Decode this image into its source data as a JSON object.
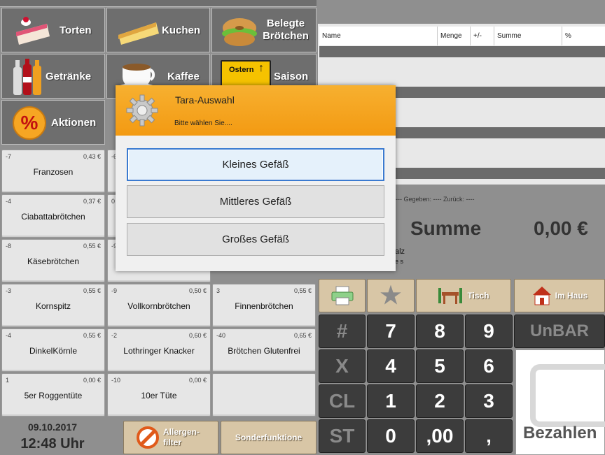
{
  "categories": [
    {
      "label": "Torten",
      "icon": "cake-icon"
    },
    {
      "label": "Kuchen",
      "icon": "pie-icon"
    },
    {
      "label": "Belegte Brötchen",
      "icon": "bagel-sandwich-icon"
    },
    {
      "label": "Getränke",
      "icon": "bottles-icon"
    },
    {
      "label": "Kaffee",
      "icon": "coffee-cup-icon"
    },
    {
      "label": "Saison",
      "icon": "signpost-icon",
      "sign_text": "Ostern"
    },
    {
      "label": "Aktionen",
      "icon": "percent-icon"
    }
  ],
  "products": [
    {
      "num": "-7",
      "price": "0,43 €",
      "name": "Franzosen"
    },
    {
      "num": "-4",
      "price": "0,37 €",
      "name": "Ciabattabrötchen"
    },
    {
      "num": "-8",
      "price": "0,55 €",
      "name": "Käsebrötchen"
    },
    {
      "num": "-3",
      "price": "0,55 €",
      "name": "Kornspitz"
    },
    {
      "num": "-9",
      "price": "0,50 €",
      "name": "Vollkornbrötchen"
    },
    {
      "num": "3",
      "price": "0,55 €",
      "name": "Finnenbrötchen"
    },
    {
      "num": "-4",
      "price": "0,55 €",
      "name": "DinkelKörnle"
    },
    {
      "num": "-2",
      "price": "0,60 €",
      "name": "Lothringer Knacker"
    },
    {
      "num": "-40",
      "price": "0,65 €",
      "name": "Brötchen Glutenfrei"
    },
    {
      "num": "1",
      "price": "0,00 €",
      "name": "5er Roggentüte"
    },
    {
      "num": "-10",
      "price": "0,00 €",
      "name": "10er Tüte"
    }
  ],
  "partial": {
    "p2num": "-6",
    "p4num": "0",
    "p6num": "-9"
  },
  "datetime": {
    "date": "09.10.2017",
    "time": "12:48 Uhr"
  },
  "bottom_buttons": {
    "allergen": "Allergen-filter",
    "special": "Sonderfunktione"
  },
  "table_headers": [
    "Name",
    "Menge",
    "+/-",
    "Summe",
    "%"
  ],
  "status": {
    "given_returned": "---- Gegeben: ---- Zurück: ----",
    "sum_label": "Summe",
    "sum_value": "0,00 €",
    "partial1": "alz",
    "partial2": "e s"
  },
  "function_keys": {
    "print_icon": "printer-icon",
    "star_icon": "star-icon",
    "table_label": "Tisch",
    "inhouse_label": "Im Haus"
  },
  "numpad": {
    "hash": "#",
    "x": "X",
    "cl": "CL",
    "st": "ST",
    "k7": "7",
    "k8": "8",
    "k9": "9",
    "k4": "4",
    "k5": "5",
    "k6": "6",
    "k1": "1",
    "k2": "2",
    "k3": "3",
    "k0": "0",
    "k00": ",00",
    "comma": ",",
    "unbar": "UnBAR",
    "pay": "Bezahlen"
  },
  "dialog": {
    "title": "Tara-Auswahl",
    "subtitle": "Bitte wählen Sie....",
    "options": [
      "Kleines Gefäß",
      "Mittleres Gefäß",
      "Großes Gefäß"
    ]
  },
  "colors": {
    "dialog_header": "#f39a12",
    "numpad": "#3c3c3c",
    "function_key": "#d8c6a6"
  }
}
